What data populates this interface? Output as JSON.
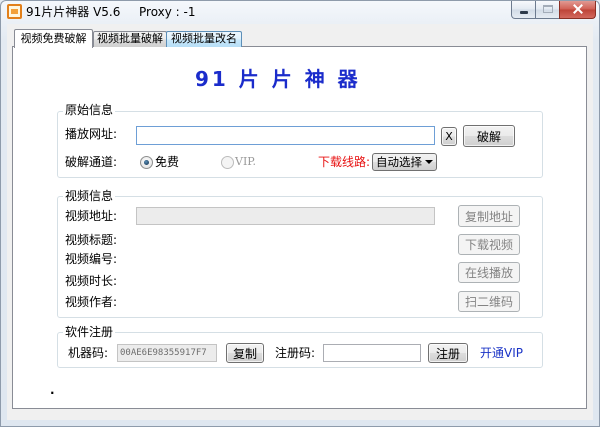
{
  "window": {
    "title": "91片片神器 V5.6",
    "proxy": "Proxy : -1",
    "icon": "app-icon",
    "controls": {
      "minimize_icon": "minimize-icon",
      "maximize_icon": "maximize-icon",
      "close_icon": "close-icon",
      "maximize_disabled": true
    }
  },
  "tabs": [
    {
      "label": "视频免费破解",
      "active": true,
      "highlighted": false
    },
    {
      "label": "视频批量破解",
      "active": false,
      "highlighted": false
    },
    {
      "label": "视频批量改名",
      "active": false,
      "highlighted": true
    }
  ],
  "heading": "91 片 片 神 器",
  "source_info": {
    "group_label": "原始信息",
    "url_label": "播放网址:",
    "url_value": "",
    "url_focused": true,
    "clear_button": "X",
    "crack_button": "破解",
    "channel_label": "破解通道:",
    "channels": [
      {
        "label": "免费",
        "checked": true,
        "disabled": false
      },
      {
        "label": "VIP.",
        "checked": false,
        "disabled": true
      }
    ],
    "route_label": "下载线路:",
    "route_selected": "自动选择",
    "route_icon": "chevron-down-icon"
  },
  "video_info": {
    "group_label": "视频信息",
    "address_label": "视频地址:",
    "address_value": "",
    "address_disabled": true,
    "title_label": "视频标题:",
    "id_label": "视频编号:",
    "duration_label": "视频时长:",
    "author_label": "视频作者:",
    "buttons": {
      "copy_address": {
        "label": "复制地址",
        "disabled": true
      },
      "download": {
        "label": "下载视频",
        "disabled": true
      },
      "play_online": {
        "label": "在线播放",
        "disabled": true
      },
      "qr_code": {
        "label": "扫二维码",
        "disabled": true
      }
    }
  },
  "registration": {
    "group_label": "软件注册",
    "machine_code_label": "机器码:",
    "machine_code_value": "00AE6E98355917F7",
    "machine_code_readonly": true,
    "copy_button": "复制",
    "reg_code_label": "注册码:",
    "reg_code_value": "",
    "register_button": "注册",
    "vip_link": "开通VIP"
  },
  "footer_mark": ".",
  "colors": {
    "heading": "#1b2ccb",
    "route_label": "#e81212",
    "vip_link": "#1a33c6",
    "close_button": "#c9473a",
    "focus_border": "#6e9fd6"
  }
}
